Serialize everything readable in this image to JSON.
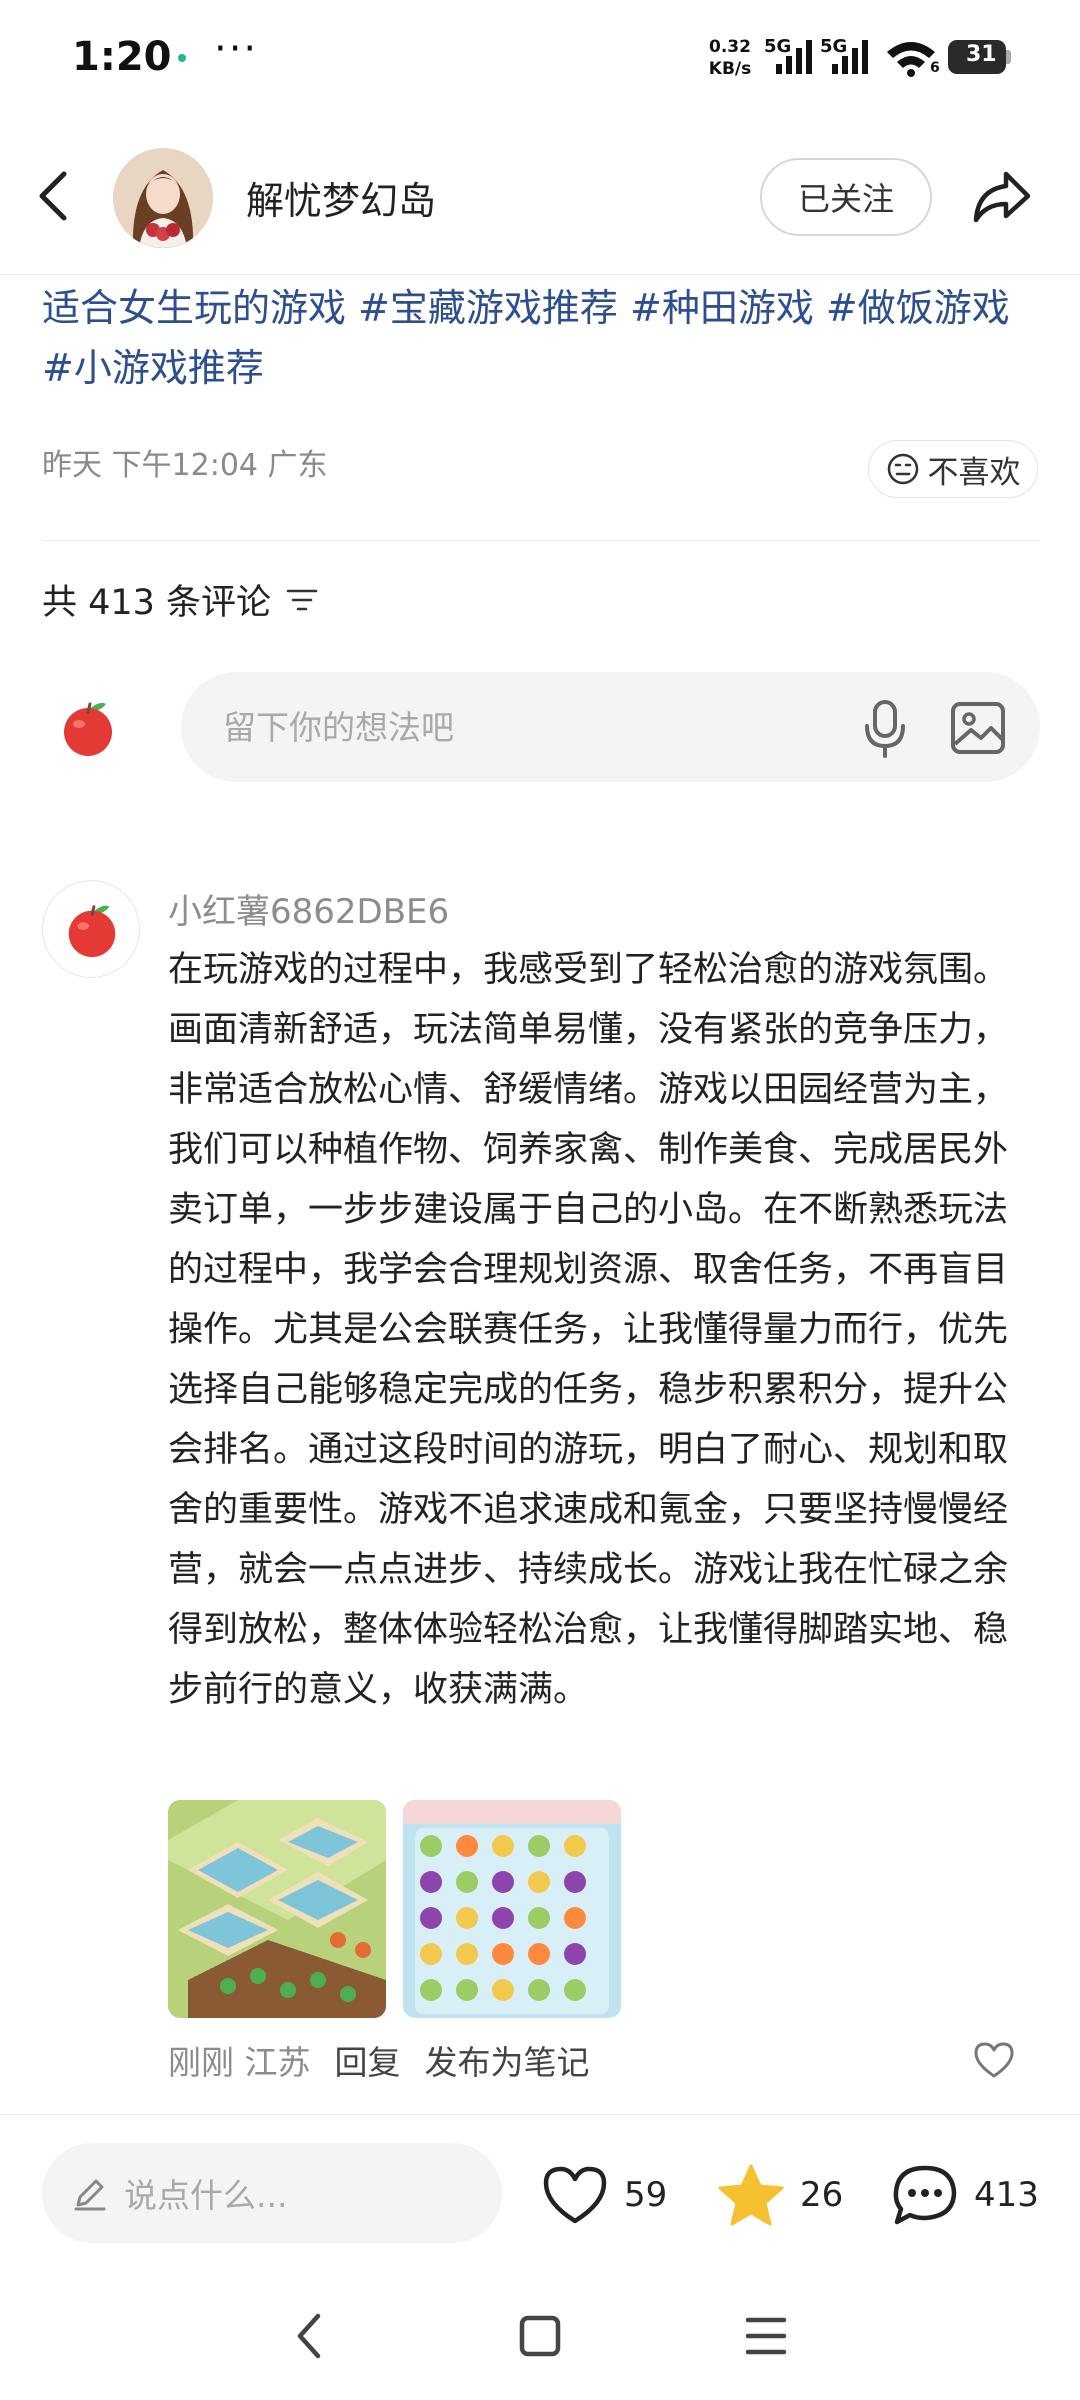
{
  "status_bar": {
    "time": "1:20",
    "more": "···",
    "net_speed_value": "0.32",
    "net_speed_unit": "KB/s",
    "sim1_label": "5G",
    "sim2_label": "5G",
    "wifi_label": "6",
    "battery_level": "31"
  },
  "header": {
    "author_name": "解忧梦幻岛",
    "follow_label": "已关注"
  },
  "post": {
    "tags_text": "适合女生玩的游戏 #宝藏游戏推荐 #种田游戏 #做饭游戏 #小游戏推荐",
    "meta_time": "昨天 下午12:04 广东",
    "dislike_label": "不喜欢"
  },
  "comments_section": {
    "count_label": "共 413 条评论",
    "input_placeholder": "留下你的想法吧"
  },
  "comment": {
    "username": "小红薯6862DBE6",
    "text": "在玩游戏的过程中，我感受到了轻松治愈的游戏氛围。画面清新舒适，玩法简单易懂，没有紧张的竞争压力，非常适合放松心情、舒缓情绪。游戏以田园经营为主，我们可以种植作物、饲养家禽、制作美食、完成居民外卖订单，一步步建设属于自己的小岛。在不断熟悉玩法的过程中，我学会合理规划资源、取舍任务，不再盲目操作。尤其是公会联赛任务，让我懂得量力而行，优先选择自己能够稳定完成的任务，稳步积累积分，提升公会排名。通过这段时间的游玩，明白了耐心、规划和取舍的重要性。游戏不追求速成和氪金，只要坚持慢慢经营，就会一点点进步、持续成长。游戏让我在忙碌之余得到放松，整体体验轻松治愈，让我懂得脚踏实地、稳步前行的意义，收获满满。",
    "time_location": "刚刚 江苏",
    "reply_label": "回复",
    "publish_label": "发布为笔记"
  },
  "bottom_bar": {
    "say_placeholder": "说点什么...",
    "likes": "59",
    "stars": "26",
    "comments": "413"
  },
  "colors": {
    "tag_blue": "#2d4f8e",
    "star_yellow": "#f5c131",
    "muted_gray": "#8c8c8c"
  }
}
